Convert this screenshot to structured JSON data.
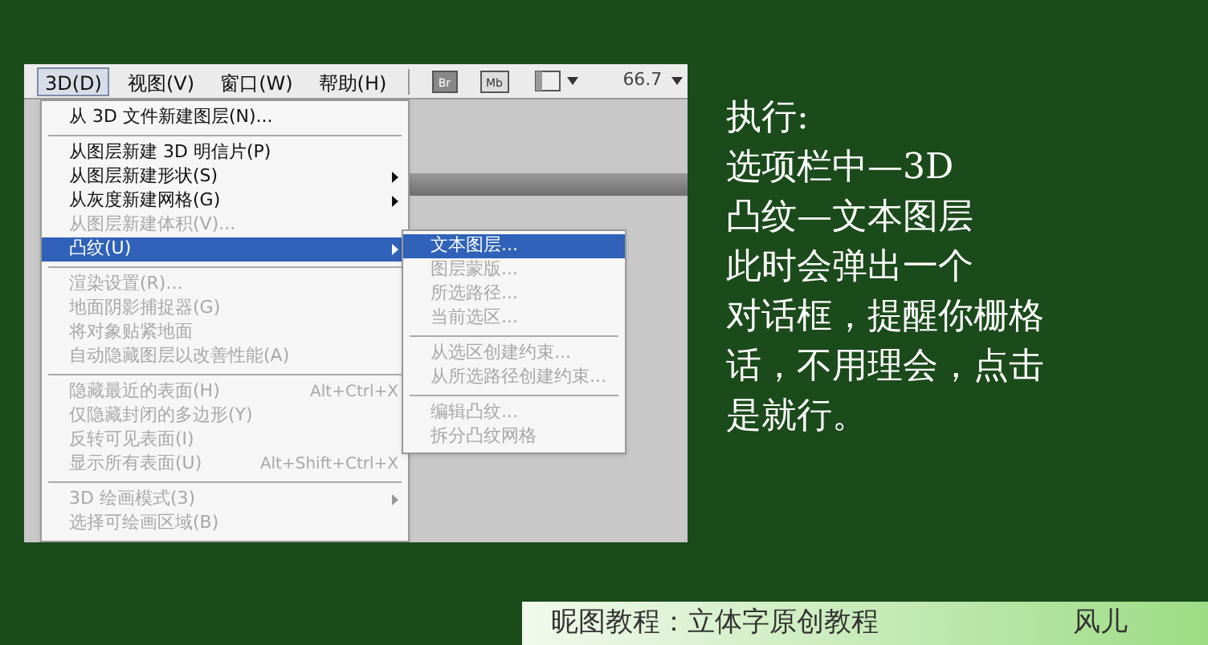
{
  "menubar": [
    {
      "label": "3D(D)",
      "selected": true
    },
    {
      "label": "视图(V)",
      "selected": false
    },
    {
      "label": "窗口(W)",
      "selected": false
    },
    {
      "label": "帮助(H)",
      "selected": false
    }
  ],
  "toolbar": [
    {
      "kind": "br",
      "label": "Br"
    },
    {
      "kind": "mb",
      "label": "Mb"
    },
    {
      "kind": "layout"
    },
    {
      "kind": "zoom",
      "label": "66.7"
    }
  ],
  "menu": [
    {
      "kind": "item",
      "label": "从 3D 文件新建图层(N)...",
      "disabled": false,
      "selected": false,
      "submenu": false
    },
    {
      "kind": "separator"
    },
    {
      "kind": "item",
      "label": "从图层新建 3D 明信片(P)",
      "disabled": false,
      "selected": false,
      "submenu": false
    },
    {
      "kind": "item",
      "label": "从图层新建形状(S)",
      "disabled": false,
      "selected": false,
      "submenu": true
    },
    {
      "kind": "item",
      "label": "从灰度新建网格(G)",
      "disabled": false,
      "selected": false,
      "submenu": true
    },
    {
      "kind": "item",
      "label": "从图层新建体积(V)...",
      "disabled": true,
      "selected": false,
      "submenu": false
    },
    {
      "kind": "item",
      "label": "凸纹(U)",
      "disabled": false,
      "selected": true,
      "submenu": true
    },
    {
      "kind": "separator"
    },
    {
      "kind": "item",
      "label": "渲染设置(R)...",
      "disabled": true,
      "selected": false,
      "submenu": false
    },
    {
      "kind": "item",
      "label": "地面阴影捕捉器(G)",
      "disabled": true,
      "selected": false,
      "submenu": false
    },
    {
      "kind": "item",
      "label": "将对象贴紧地面",
      "disabled": true,
      "selected": false,
      "submenu": false
    },
    {
      "kind": "item",
      "label": "自动隐藏图层以改善性能(A)",
      "disabled": true,
      "selected": false,
      "submenu": false
    },
    {
      "kind": "separator"
    },
    {
      "kind": "item",
      "label": "隐藏最近的表面(H)",
      "shortcut": "Alt+Ctrl+X",
      "disabled": true,
      "selected": false,
      "submenu": false
    },
    {
      "kind": "item",
      "label": "仅隐藏封闭的多边形(Y)",
      "disabled": true,
      "selected": false,
      "submenu": false
    },
    {
      "kind": "item",
      "label": "反转可见表面(I)",
      "disabled": true,
      "selected": false,
      "submenu": false
    },
    {
      "kind": "item",
      "label": "显示所有表面(U)",
      "shortcut": "Alt+Shift+Ctrl+X",
      "disabled": true,
      "selected": false,
      "submenu": false
    },
    {
      "kind": "separator"
    },
    {
      "kind": "item",
      "label": "3D 绘画模式(3)",
      "disabled": true,
      "selected": false,
      "submenu": true
    },
    {
      "kind": "item",
      "label": "选择可绘画区域(B)",
      "disabled": true,
      "selected": false,
      "submenu": false
    }
  ],
  "submenu": [
    {
      "kind": "item",
      "label": "文本图层...",
      "disabled": false,
      "selected": true
    },
    {
      "kind": "item",
      "label": "图层蒙版...",
      "disabled": true,
      "selected": false
    },
    {
      "kind": "item",
      "label": "所选路径...",
      "disabled": true,
      "selected": false
    },
    {
      "kind": "item",
      "label": "当前选区...",
      "disabled": true,
      "selected": false
    },
    {
      "kind": "separator"
    },
    {
      "kind": "item",
      "label": "从选区创建约束...",
      "disabled": true,
      "selected": false
    },
    {
      "kind": "item",
      "label": "从所选路径创建约束...",
      "disabled": true,
      "selected": false
    },
    {
      "kind": "separator"
    },
    {
      "kind": "item",
      "label": "编辑凸纹...",
      "disabled": true,
      "selected": false
    },
    {
      "kind": "item",
      "label": "拆分凸纹网格",
      "disabled": true,
      "selected": false
    }
  ],
  "note": [
    "执行:",
    "选项栏中—3D",
    "凸纹—文本图层",
    "此时会弹出一个",
    "对话框，提醒你栅格",
    "话，不用理会，点击",
    "是就行。"
  ],
  "footer": {
    "title": "昵图教程：立体字原创教程",
    "author": "风儿"
  }
}
